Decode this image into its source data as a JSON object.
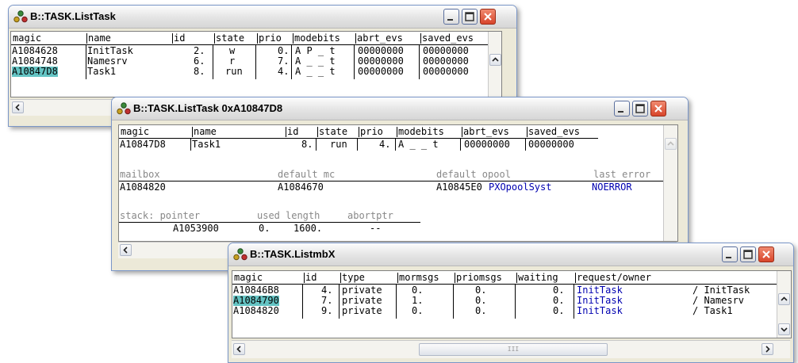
{
  "windows": {
    "w1": {
      "title": "B::TASK.ListTask",
      "headers": [
        "magic",
        "name",
        "id",
        "state",
        "prio",
        "modebits",
        "abrt_evs",
        "saved_evs"
      ],
      "rows": [
        {
          "magic": "A1084628",
          "name": "InitTask",
          "id": "2.",
          "state": "w",
          "prio": "0.",
          "modebits": "A P _ t",
          "abrt_evs": "00000000",
          "saved_evs": "00000000"
        },
        {
          "magic": "A1084748",
          "name": "Namesrv",
          "id": "6.",
          "state": "r",
          "prio": "7.",
          "modebits": "A _ _ t",
          "abrt_evs": "00000000",
          "saved_evs": "00000000"
        },
        {
          "magic": "A10847D8",
          "name": "Task1",
          "id": "8.",
          "state": "run",
          "prio": "4.",
          "modebits": "A _ _ t",
          "abrt_evs": "00000000",
          "saved_evs": "00000000"
        }
      ]
    },
    "w2": {
      "title": "B::TASK.ListTask 0xA10847D8",
      "headers": [
        "magic",
        "name",
        "id",
        "state",
        "prio",
        "modebits",
        "abrt_evs",
        "saved_evs"
      ],
      "row": {
        "magic": "A10847D8",
        "name": "Task1",
        "id": "8.",
        "state": "run",
        "prio": "4.",
        "modebits": "A _ _ t",
        "abrt_evs": "00000000",
        "saved_evs": "00000000"
      },
      "mailbox_label": "mailbox",
      "mailbox_value": "A1084820",
      "default_mc_label": "default mc",
      "default_mc_value": "A1084670",
      "default_opool_label": "default opool",
      "default_opool_value": "A10845E0",
      "default_opool_name": "PXOpoolSyst",
      "last_error_label": "last error",
      "last_error_value": "NOERROR",
      "stack_label": "stack: pointer",
      "used_label": "used",
      "length_label": "length",
      "abortptr_label": "abortptr",
      "stack_pointer": "A1053900",
      "used_value": "0.",
      "length_value": "1600.",
      "abortptr_value": "--"
    },
    "w3": {
      "title": "B::TASK.ListmbX",
      "headers": [
        "magic",
        "id",
        "type",
        "mormsgs",
        "priomsgs",
        "waiting",
        "request/owner"
      ],
      "rows": [
        {
          "magic": "A10846B8",
          "id": "4.",
          "type": "private",
          "mormsgs": "0.",
          "priomsgs": "0.",
          "waiting": "0.",
          "request": "InitTask",
          "owner": "/ InitTask"
        },
        {
          "magic": "A1084790",
          "id": "7.",
          "type": "private",
          "mormsgs": "1.",
          "priomsgs": "0.",
          "waiting": "0.",
          "request": "InitTask",
          "owner": "/ Namesrv"
        },
        {
          "magic": "A1084820",
          "id": "9.",
          "type": "private",
          "mormsgs": "0.",
          "priomsgs": "0.",
          "waiting": "0.",
          "request": "InitTask",
          "owner": "/ Task1"
        }
      ],
      "hscroll_grip": "III"
    }
  }
}
